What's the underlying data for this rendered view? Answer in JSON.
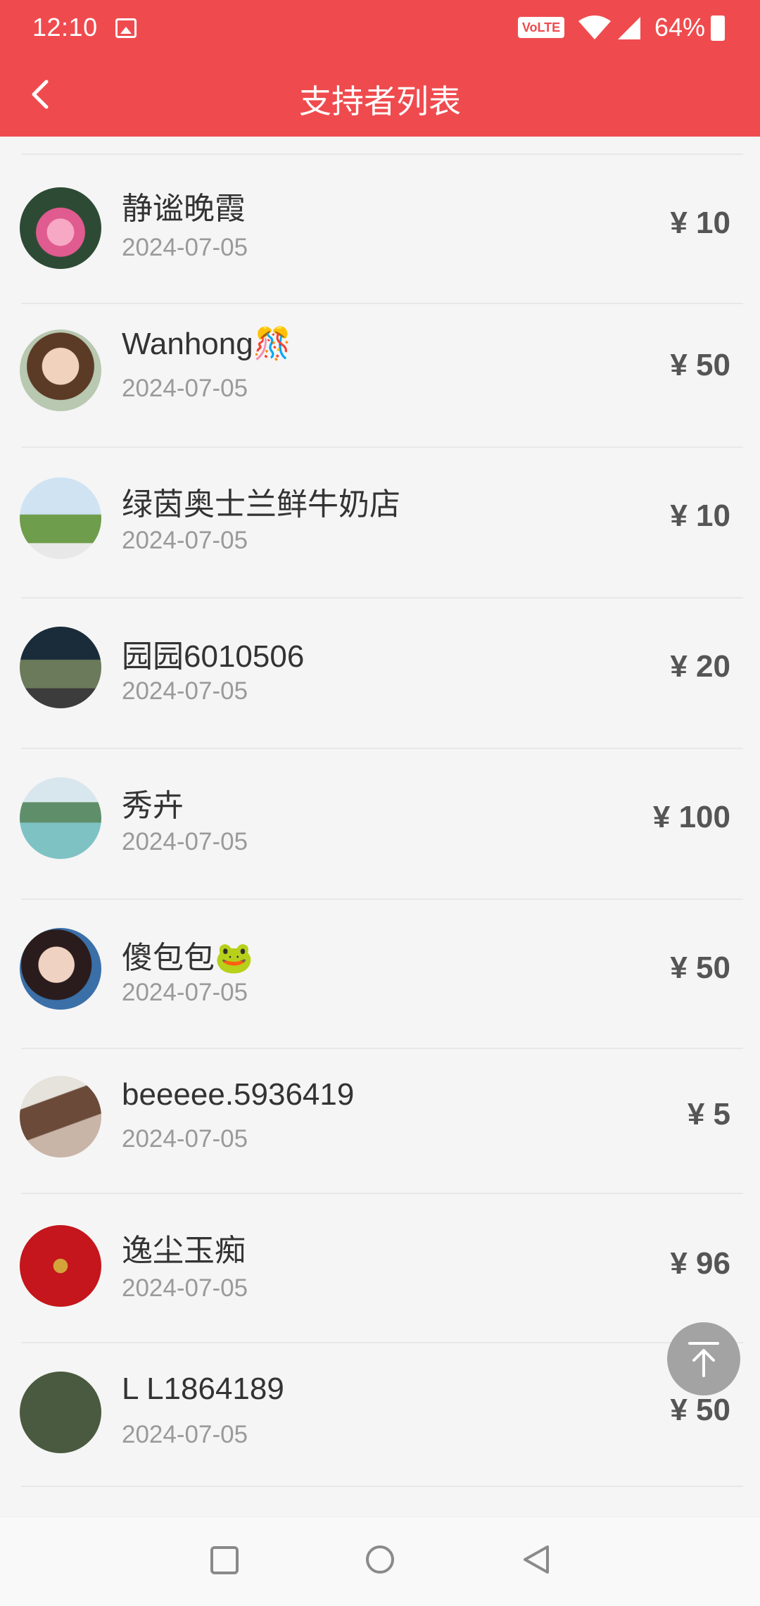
{
  "status_bar": {
    "time": "12:10",
    "volte": "VoLTE",
    "battery": "64%"
  },
  "header": {
    "title": "支持者列表"
  },
  "currency": "¥",
  "supporters": [
    {
      "name": "静谧晚霞",
      "date": "2024-07-05",
      "amount": "¥ 10"
    },
    {
      "name": "Wanhong🎊",
      "date": "2024-07-05",
      "amount": "¥ 50"
    },
    {
      "name": "绿茵奥士兰鲜牛奶店",
      "date": "2024-07-05",
      "amount": "¥ 10"
    },
    {
      "name": "园园6010506",
      "date": "2024-07-05",
      "amount": "¥ 20"
    },
    {
      "name": "秀卉",
      "date": "2024-07-05",
      "amount": "¥ 100"
    },
    {
      "name": "傻包包🐸",
      "date": "2024-07-05",
      "amount": "¥ 50"
    },
    {
      "name": "beeeee.5936419",
      "date": "2024-07-05",
      "amount": "¥ 5"
    },
    {
      "name": "逸尘玉痴",
      "date": "2024-07-05",
      "amount": "¥ 96"
    },
    {
      "name": "L L1864189",
      "date": "2024-07-05",
      "amount": "¥ 50"
    }
  ],
  "colors": {
    "brand": "#ef4b4e"
  }
}
